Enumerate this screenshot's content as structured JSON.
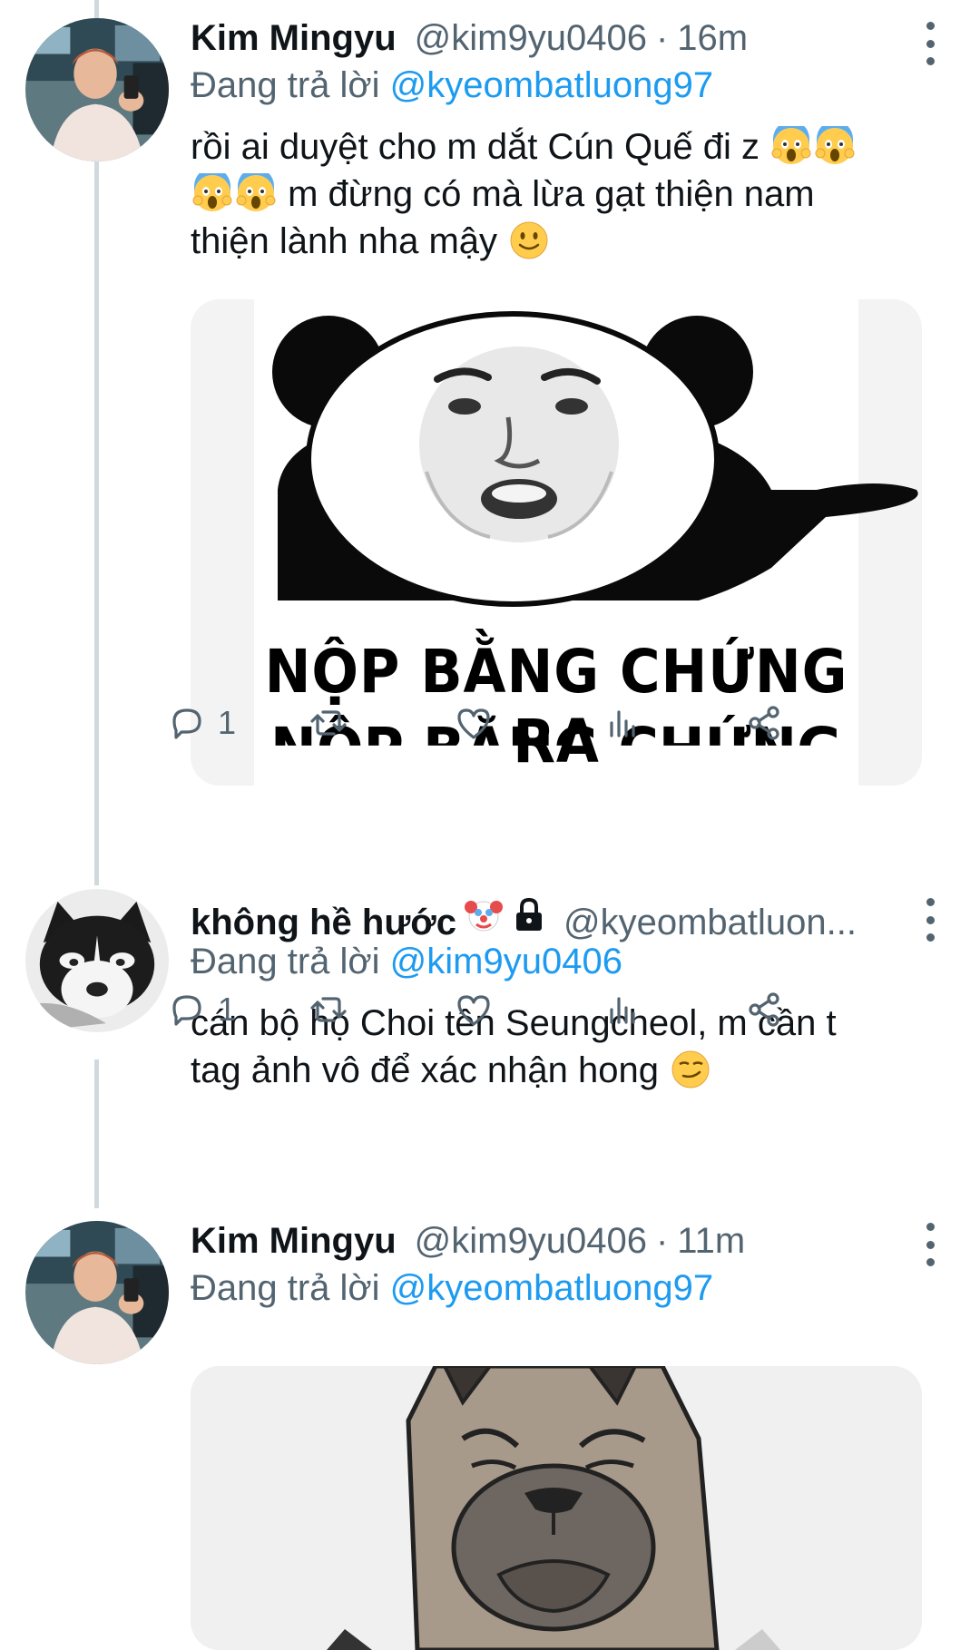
{
  "tweets": [
    {
      "name": "Kim Mingyu",
      "handle": "@kim9yu0406",
      "time": "16m",
      "reply_prefix": "Đang trả lời",
      "reply_to": "@kyeombatluong97",
      "text_line1": "rồi ai duyệt cho m dắt Cún Quế đi z",
      "text_line2": " m đừng có mà lừa gạt thiện nam",
      "text_line3": "thiện lành nha mậy",
      "media_caption": "NỘP BẰNG CHỨNG RA",
      "media_caption_cut": "NỘP BẰNG CHỨNG RA",
      "replies": "1",
      "icons": [
        "reply-icon",
        "retweet-icon",
        "like-icon",
        "analytics-icon",
        "share-icon"
      ]
    },
    {
      "name": "không hề hước",
      "handle": "@kyeombatluon...",
      "reply_prefix": "Đang trả lời",
      "reply_to": "@kim9yu0406",
      "text_line1": "cán bộ họ Choi tên Seungcheol, m cần t",
      "text_line2": "tag ảnh vô để xác nhận hong",
      "replies": "1",
      "name_emojis": [
        "clown-emoji",
        "lock-icon"
      ]
    },
    {
      "name": "Kim Mingyu",
      "handle": "@kim9yu0406",
      "time": "11m",
      "reply_prefix": "Đang trả lời",
      "reply_to": "@kyeombatluong97"
    }
  ],
  "colors": {
    "text": "#0f1419",
    "secondary": "#536471",
    "link": "#1d9bf0",
    "thread_line": "#cfd9de"
  }
}
